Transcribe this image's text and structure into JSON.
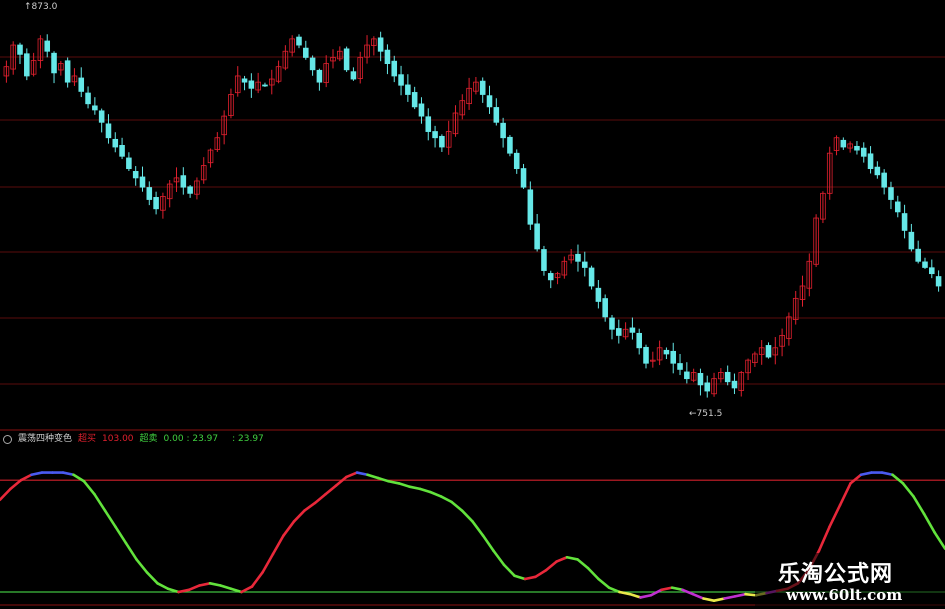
{
  "panel_top": {
    "high_label": "873.0",
    "low_label": "751.5"
  },
  "panel_bottom": {
    "name": "震荡四种变色",
    "buy_label": "超买",
    "buy_value": "103.00",
    "sell_label": "超卖",
    "sell_value": "0.00 : 23.97",
    "extra_value": ": 23.97"
  },
  "watermark": {
    "title": "乐淘公式网",
    "url": "www.60lt.com"
  },
  "colors": {
    "up": "#e0202e",
    "down": "#66e8e8",
    "grid": "#5a0c0c",
    "osc_up": "#e8283a",
    "osc_down": "#62e23c",
    "osc_low": "#e8e84a",
    "osc_magenta": "#c030d0",
    "osc_top": "#4a5af0",
    "line_overbought": "#d0202a",
    "line_oversold": "#40c040"
  },
  "chart_data": [
    {
      "type": "candlestick",
      "ylim": [
        745,
        880
      ],
      "labels": {
        "high": 873.0,
        "low": 751.5
      },
      "close": [
        861,
        868,
        865,
        858,
        863,
        870,
        866,
        859,
        862,
        856,
        858,
        853,
        849,
        847,
        843,
        838,
        835,
        832,
        828,
        825,
        822,
        818,
        815,
        819,
        823,
        825,
        822,
        820,
        824,
        829,
        834,
        838,
        845,
        852,
        858,
        856,
        854,
        856,
        855,
        857,
        861,
        866,
        870,
        868,
        864,
        860,
        856,
        862,
        864,
        866,
        860,
        857,
        864,
        868,
        870,
        866,
        862,
        858,
        855,
        852,
        848,
        845,
        840,
        838,
        835,
        840,
        846,
        850,
        854,
        856,
        852,
        848,
        843,
        838,
        833,
        828,
        822,
        810,
        802,
        795,
        792,
        794,
        798,
        800,
        798,
        796,
        790,
        785,
        780,
        776,
        774,
        776,
        775,
        770,
        765,
        766,
        770,
        768,
        765,
        763,
        760,
        762,
        758,
        756,
        760,
        762,
        759,
        757,
        762,
        766,
        768,
        770,
        767,
        770,
        774,
        780,
        786,
        790,
        798,
        812,
        820,
        833,
        838,
        835,
        836,
        834,
        832,
        828,
        826,
        822,
        818,
        814,
        808,
        802,
        798,
        796,
        794,
        790
      ]
    },
    {
      "type": "line",
      "ylim": [
        0,
        140
      ],
      "overbought": 103.0,
      "oversold": 0.0,
      "values": [
        85,
        95,
        103,
        108,
        110,
        110,
        110,
        108,
        102,
        90,
        75,
        60,
        45,
        30,
        18,
        8,
        3,
        0,
        2,
        6,
        8,
        6,
        3,
        0,
        5,
        18,
        35,
        52,
        65,
        75,
        82,
        90,
        98,
        106,
        110,
        108,
        105,
        102,
        100,
        97,
        95,
        92,
        88,
        83,
        75,
        65,
        52,
        38,
        25,
        15,
        12,
        14,
        20,
        28,
        32,
        30,
        22,
        12,
        4,
        0,
        -2,
        -5,
        -3,
        2,
        4,
        2,
        -2,
        -6,
        -8,
        -6,
        -4,
        -2,
        -3,
        -1,
        1,
        3,
        8,
        20,
        38,
        60,
        80,
        100,
        108,
        110,
        110,
        108,
        100,
        88,
        72,
        55,
        40
      ]
    }
  ]
}
